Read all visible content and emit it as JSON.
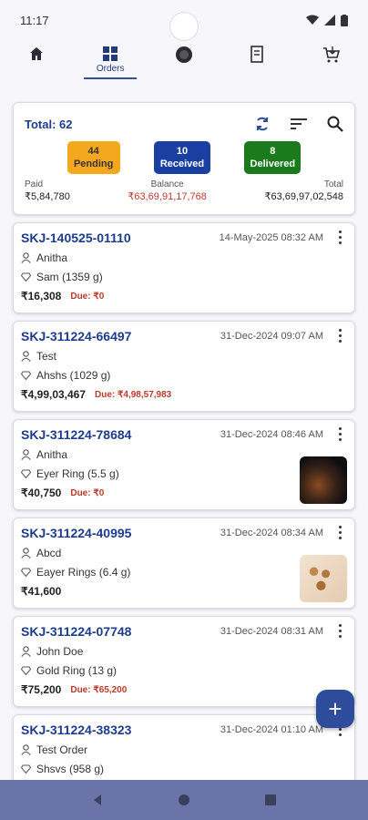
{
  "status_bar": {
    "time": "11:17"
  },
  "tabs": [
    {
      "icon": "home-icon",
      "label": ""
    },
    {
      "icon": "grid-icon",
      "label": "Orders"
    },
    {
      "icon": "badge-icon",
      "label": ""
    },
    {
      "icon": "receipt-icon",
      "label": ""
    },
    {
      "icon": "cart-icon",
      "label": ""
    }
  ],
  "summary": {
    "total_label": "Total: 62",
    "chips": [
      {
        "count": "44",
        "label": "Pending"
      },
      {
        "count": "10",
        "label": "Received"
      },
      {
        "count": "8",
        "label": "Delivered"
      }
    ],
    "paid_label": "Paid",
    "paid_value": "₹5,84,780",
    "balance_label": "Balance",
    "balance_value": "₹63,69,91,17,768",
    "total_label2": "Total",
    "total_value": "₹63,69,97,02,548"
  },
  "orders": [
    {
      "id": "SKJ-140525-01110",
      "date": "14-May-2025 08:32 AM",
      "customer": "Anitha",
      "item": "Sam (1359 g)",
      "price": "₹16,308",
      "due": "Due: ₹0"
    },
    {
      "id": "SKJ-311224-66497",
      "date": "31-Dec-2024 09:07 AM",
      "customer": "Test",
      "item": "Ahshs (1029 g)",
      "price": "₹4,99,03,467",
      "due": "Due: ₹4,98,57,983"
    },
    {
      "id": "SKJ-311224-78684",
      "date": "31-Dec-2024 08:46 AM",
      "customer": "Anitha",
      "item": "Eyer Ring (5.5 g)",
      "price": "₹40,750",
      "due": "Due: ₹0"
    },
    {
      "id": "SKJ-311224-40995",
      "date": "31-Dec-2024 08:34 AM",
      "customer": "Abcd",
      "item": "Eayer Rings (6.4 g)",
      "price": "₹41,600",
      "due": ""
    },
    {
      "id": "SKJ-311224-07748",
      "date": "31-Dec-2024 08:31 AM",
      "customer": "John Doe",
      "item": "Gold Ring (13 g)",
      "price": "₹75,200",
      "due": "Due: ₹65,200"
    },
    {
      "id": "SKJ-311224-38323",
      "date": "31-Dec-2024 01:10 AM",
      "customer": "Test Order",
      "item": "Shsvs (958 g)",
      "price": "",
      "due": ""
    }
  ],
  "fab": {
    "label": "+"
  }
}
